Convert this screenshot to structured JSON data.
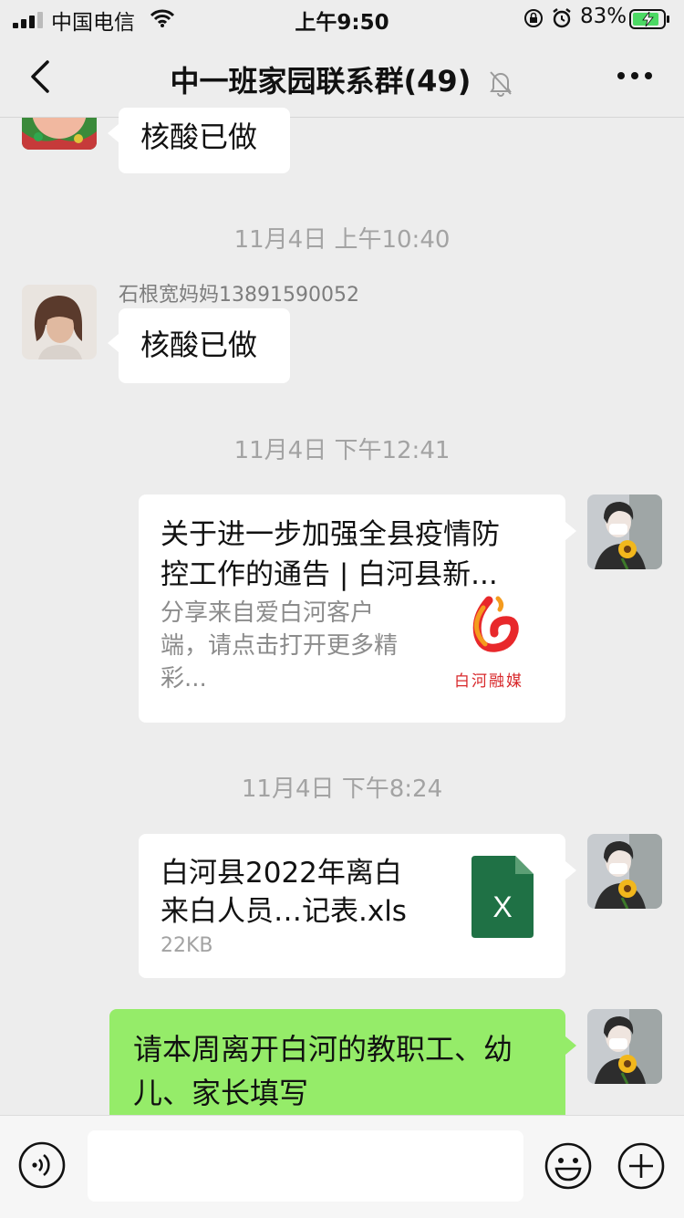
{
  "status_bar": {
    "carrier": "中国电信",
    "time": "上午9:50",
    "battery_percent": "83%"
  },
  "nav": {
    "title": "中一班家园联系群(49)",
    "back_icon": "chevron-left-icon",
    "mute_icon": "bell-off-icon",
    "more_icon": "more-dots-icon"
  },
  "messages": [
    {
      "type": "text",
      "side": "left",
      "text": "核酸已做"
    },
    {
      "type": "timestamp",
      "text": "11月4日 上午10:40"
    },
    {
      "type": "text",
      "side": "left",
      "sender": "石根宽妈妈13891590052",
      "text": "核酸已做"
    },
    {
      "type": "timestamp",
      "text": "11月4日 下午12:41"
    },
    {
      "type": "link",
      "side": "right",
      "title": "关于进一步加强全县疫情防控工作的通告 | 白河县新...",
      "desc": "分享来自爱白河客户端，请点击打开更多精彩...",
      "thumb_label": "白河融媒"
    },
    {
      "type": "timestamp",
      "text": "11月4日 下午8:24"
    },
    {
      "type": "file",
      "side": "right",
      "filename": "白河县2022年离白来白人员…记表.xls",
      "size": "22KB",
      "icon_letter": "X"
    },
    {
      "type": "text",
      "side": "right",
      "text": "请本周离开白河的教职工、幼儿、家长填写"
    }
  ],
  "link_title_lines": [
    "关于进一步加强全县疫情防",
    "控工作的通告 | 白河县新..."
  ],
  "link_desc_lines": [
    "分享来自爱白河客户",
    "端，请点击打开更多精",
    "彩..."
  ],
  "file_name_lines": [
    "白河县2022年离白",
    "来白人员…记表.xls"
  ],
  "green_text_lines": [
    "请本周离开白河的教职工、幼",
    "儿、家长填写"
  ],
  "input_bar": {
    "voice_icon": "voice-icon",
    "emoji_icon": "emoji-icon",
    "plus_icon": "plus-icon"
  },
  "colors": {
    "background": "#ededed",
    "bubble_white": "#ffffff",
    "bubble_green": "#95ec69",
    "excel_green": "#1f7145",
    "timestamp_gray": "#a3a3a3"
  }
}
